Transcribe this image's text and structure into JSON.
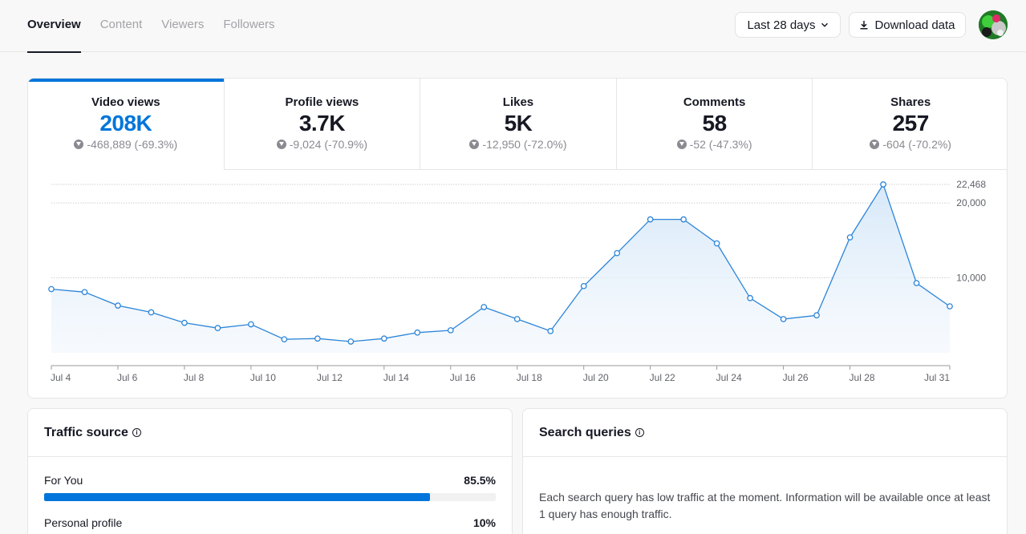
{
  "tabs": [
    {
      "label": "Overview",
      "active": true
    },
    {
      "label": "Content",
      "active": false
    },
    {
      "label": "Viewers",
      "active": false
    },
    {
      "label": "Followers",
      "active": false
    }
  ],
  "header": {
    "date_range_label": "Last 28 days",
    "download_label": "Download data"
  },
  "metrics": [
    {
      "label": "Video views",
      "value": "208K",
      "change": "-468,889 (-69.3%)",
      "active": true
    },
    {
      "label": "Profile views",
      "value": "3.7K",
      "change": "-9,024 (-70.9%)",
      "active": false
    },
    {
      "label": "Likes",
      "value": "5K",
      "change": "-12,950 (-72.0%)",
      "active": false
    },
    {
      "label": "Comments",
      "value": "58",
      "change": "-52 (-47.3%)",
      "active": false
    },
    {
      "label": "Shares",
      "value": "257",
      "change": "-604 (-70.2%)",
      "active": false
    }
  ],
  "chart_data": {
    "type": "area",
    "x": [
      "Jul 4",
      "Jul 5",
      "Jul 6",
      "Jul 7",
      "Jul 8",
      "Jul 9",
      "Jul 10",
      "Jul 11",
      "Jul 12",
      "Jul 13",
      "Jul 14",
      "Jul 15",
      "Jul 16",
      "Jul 17",
      "Jul 18",
      "Jul 19",
      "Jul 20",
      "Jul 21",
      "Jul 22",
      "Jul 23",
      "Jul 24",
      "Jul 25",
      "Jul 26",
      "Jul 27",
      "Jul 28",
      "Jul 29",
      "Jul 30",
      "Jul 31"
    ],
    "x_tick_labels": [
      "Jul 4",
      "Jul 6",
      "Jul 8",
      "Jul 10",
      "Jul 12",
      "Jul 14",
      "Jul 16",
      "Jul 18",
      "Jul 20",
      "Jul 22",
      "Jul 24",
      "Jul 26",
      "Jul 28",
      "Jul 31"
    ],
    "values": [
      8500,
      8100,
      6300,
      5400,
      4000,
      3300,
      3800,
      1800,
      1900,
      1500,
      1900,
      2700,
      3000,
      6100,
      4500,
      2900,
      8900,
      13300,
      17800,
      17800,
      14600,
      7300,
      4500,
      5000,
      15400,
      22468,
      9300,
      6200
    ],
    "y_ticks": [
      10000,
      20000,
      22468
    ],
    "y_tick_labels": [
      "10,000",
      "20,000",
      "22,468"
    ],
    "ylim": [
      0,
      22468
    ],
    "grid": true,
    "color": "#2c85d8"
  },
  "traffic_source": {
    "title": "Traffic source",
    "items": [
      {
        "label": "For You",
        "value": "85.5%",
        "fraction": 0.855
      },
      {
        "label": "Personal profile",
        "value": "10%",
        "fraction": 0.1
      }
    ]
  },
  "search_queries": {
    "title": "Search queries",
    "message": "Each search query has low traffic at the moment. Information will be available once at least 1 query has enough traffic."
  },
  "colors": {
    "accent": "#0075db",
    "text": "#161823",
    "muted": "#8a8b91"
  }
}
